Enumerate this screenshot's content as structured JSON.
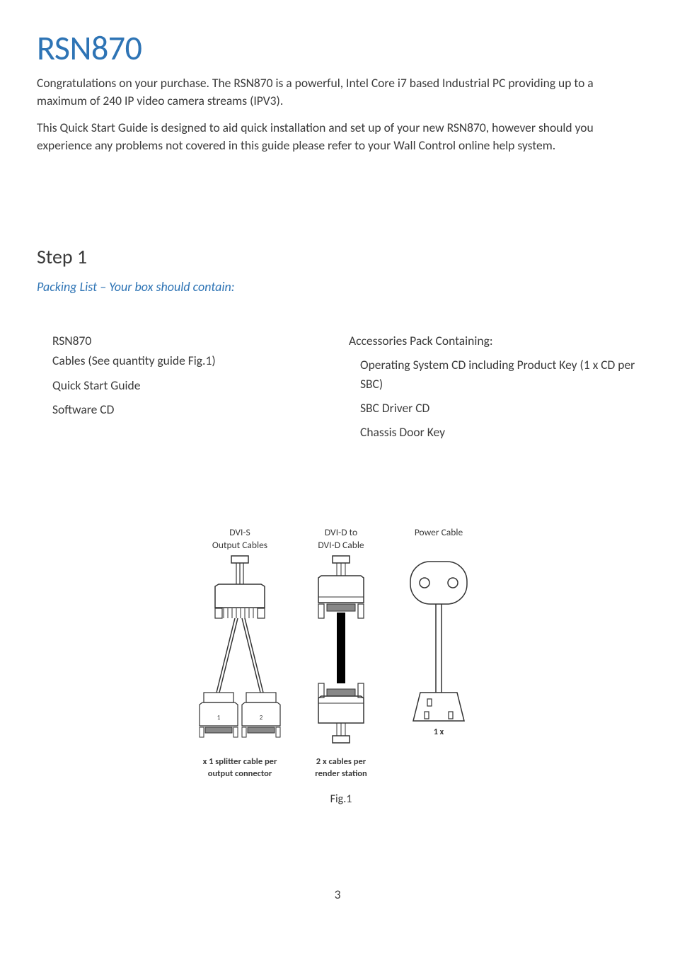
{
  "title": "RSN870",
  "paragraphs": {
    "p1": "Congratulations on your purchase.  The RSN870 is a powerful, Intel Core i7 based Industrial PC providing up to a maximum of 240 IP video camera streams (IPV3).",
    "p2": "This Quick Start Guide is designed to aid quick installation and set up of your new RSN870, however should you experience any problems not covered in this guide please refer to your Wall Control online help system."
  },
  "step": {
    "heading": "Step 1",
    "subheading": "Packing List – Your box should contain:"
  },
  "packing": {
    "left": [
      "RSN870",
      "Cables  (See quantity guide Fig.1)",
      "Quick Start Guide",
      "Software CD"
    ],
    "right_heading": "Accessories Pack Containing:",
    "right_items": [
      "Operating System CD including Product Key (1 x CD per SBC)",
      "SBC Driver CD",
      "Chassis Door Key"
    ]
  },
  "figure": {
    "col1": {
      "label_l1": "DVI-S",
      "label_l2": "Output Cables",
      "caption_l1": "x 1 splitter cable per",
      "caption_l2": "output connector"
    },
    "col2": {
      "label_l1": "DVI-D to",
      "label_l2": "DVI-D Cable",
      "caption_l1": "2 x cables per",
      "caption_l2": "render station",
      "sep_count1": "1",
      "sep_count2": "2"
    },
    "col3": {
      "label": "Power Cable",
      "count": "1 x"
    },
    "caption": "Fig.1"
  },
  "page_number": "3"
}
